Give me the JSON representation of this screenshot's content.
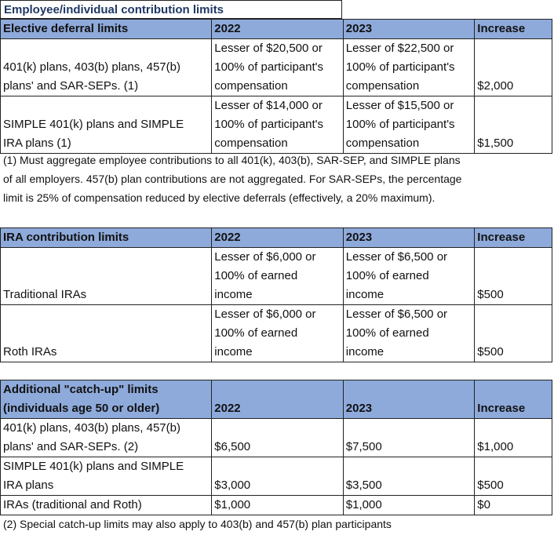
{
  "title": "Employee/individual contribution limits",
  "tables": [
    {
      "headers": [
        "Elective deferral limits",
        "2022",
        "2023",
        "Increase"
      ],
      "rows": [
        {
          "label": [
            "401(k) plans, 403(b) plans, 457(b)",
            "plans' and SAR-SEPs. (1)"
          ],
          "y2022": [
            "Lesser of $20,500 or",
            "100% of participant's",
            "compensation"
          ],
          "y2023": [
            "Lesser of $22,500 or",
            "100% of participant's",
            "compensation"
          ],
          "increase": "$2,000"
        },
        {
          "label": [
            "SIMPLE 401(k) plans and SIMPLE",
            "IRA plans (1)"
          ],
          "y2022": [
            "Lesser of $14,000 or",
            "100% of participant's",
            "compensation"
          ],
          "y2023": [
            "Lesser of $15,500 or",
            "100% of participant's",
            "compensation"
          ],
          "increase": "$1,500"
        }
      ],
      "note": [
        "(1) Must aggregate employee contributions to all 401(k), 403(b), SAR-SEP, and SIMPLE plans",
        "of all employers. 457(b) plan contributions are not aggregated. For SAR-SEPs, the percentage",
        "limit is 25% of compensation reduced by elective deferrals (effectively, a 20% maximum)."
      ]
    },
    {
      "headers": [
        "IRA contribution limits",
        "2022",
        "2023",
        "Increase"
      ],
      "rows": [
        {
          "label": [
            "Traditional IRAs"
          ],
          "y2022": [
            "Lesser of $6,000 or",
            "100% of earned",
            "income"
          ],
          "y2023": [
            "Lesser of $6,500 or",
            "100% of earned",
            "income"
          ],
          "increase": "$500"
        },
        {
          "label": [
            "Roth IRAs"
          ],
          "y2022": [
            "Lesser of $6,000 or",
            "100% of earned",
            "income"
          ],
          "y2023": [
            "Lesser of $6,500 or",
            "100% of earned",
            "income"
          ],
          "increase": "$500"
        }
      ]
    },
    {
      "headers": [
        "Additional \"catch-up\" limits",
        "(individuals age 50 or older)",
        "2022",
        "2023",
        "Increase"
      ],
      "rows": [
        {
          "label": [
            "401(k) plans, 403(b) plans, 457(b)",
            "plans' and SAR-SEPs. (2)"
          ],
          "y2022": [
            "$6,500"
          ],
          "y2023": [
            "$7,500"
          ],
          "increase": "$1,000"
        },
        {
          "label": [
            "SIMPLE 401(k) plans and SIMPLE",
            "IRA plans"
          ],
          "y2022": [
            "$3,000"
          ],
          "y2023": [
            "$3,500"
          ],
          "increase": "$500"
        },
        {
          "label": [
            "IRAs (traditional and Roth)"
          ],
          "y2022": [
            "$1,000"
          ],
          "y2023": [
            "$1,000"
          ],
          "increase": "$0"
        }
      ],
      "note": [
        "(2) Special catch-up limits may also apply to 403(b) and 457(b) plan participants"
      ]
    }
  ]
}
